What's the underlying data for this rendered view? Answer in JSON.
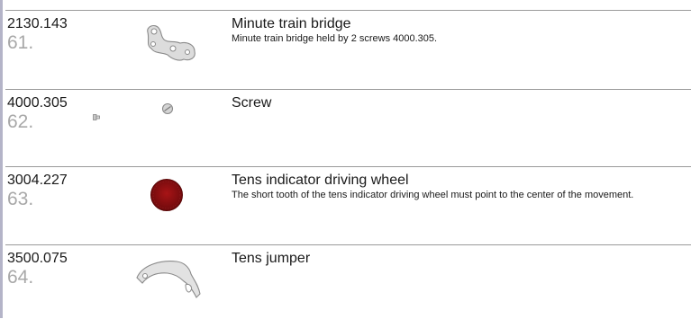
{
  "rows": [
    {
      "ref": "2130.143",
      "num": "61.",
      "title": "Minute train bridge",
      "desc": "Minute train bridge held by 2 screws 4000.305.",
      "icon": "bridge-part-icon"
    },
    {
      "ref": "4000.305",
      "num": "62.",
      "title": "Screw",
      "desc": "",
      "icon": "screw-icon"
    },
    {
      "ref": "3004.227",
      "num": "63.",
      "title": "Tens indicator driving wheel",
      "desc": "The short tooth of the tens indicator driving wheel must point to the center of the movement.",
      "icon": "red-wheel-icon"
    },
    {
      "ref": "3500.075",
      "num": "64.",
      "title": "Tens jumper",
      "desc": "",
      "icon": "jumper-part-icon"
    }
  ],
  "colors": {
    "wheel": "#8e0e10",
    "rule": "#9a9a9a",
    "number": "#a8a8a8"
  }
}
